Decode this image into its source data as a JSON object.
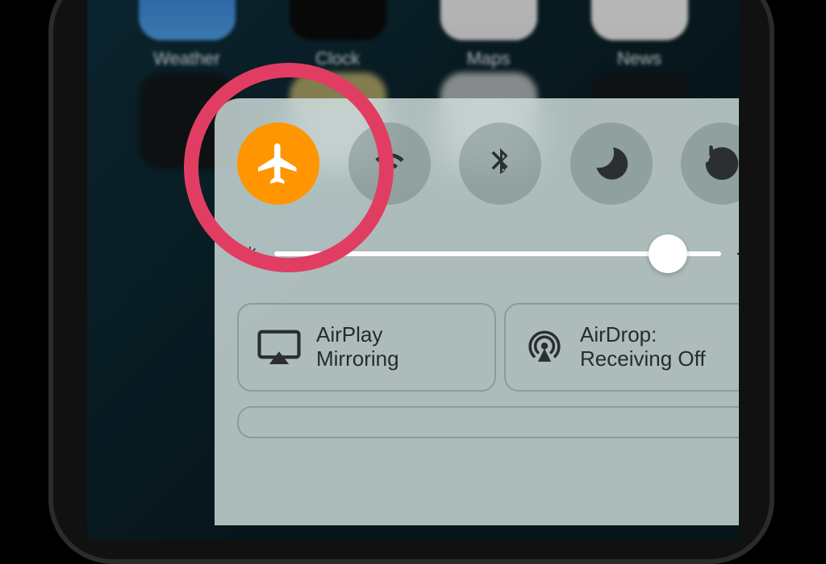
{
  "home_apps_row1": {
    "weather": "Weather",
    "clock": "Clock",
    "maps": "Maps",
    "news": "News"
  },
  "control_center": {
    "toggles": {
      "airplane_mode": {
        "active": true
      },
      "wifi": {
        "active": false
      },
      "bluetooth": {
        "active": false
      },
      "do_not_disturb": {
        "active": false
      },
      "orientation_lock": {
        "active": false
      }
    },
    "brightness_percent": 88,
    "airplay": {
      "line1": "AirPlay",
      "line2": "Mirroring"
    },
    "airdrop": {
      "line1": "AirDrop:",
      "line2": "Receiving Off"
    }
  },
  "annotation": {
    "circle_color": "#e13d62",
    "target": "airplane-mode-toggle"
  },
  "colors": {
    "airplane_active": "#ff9500"
  }
}
